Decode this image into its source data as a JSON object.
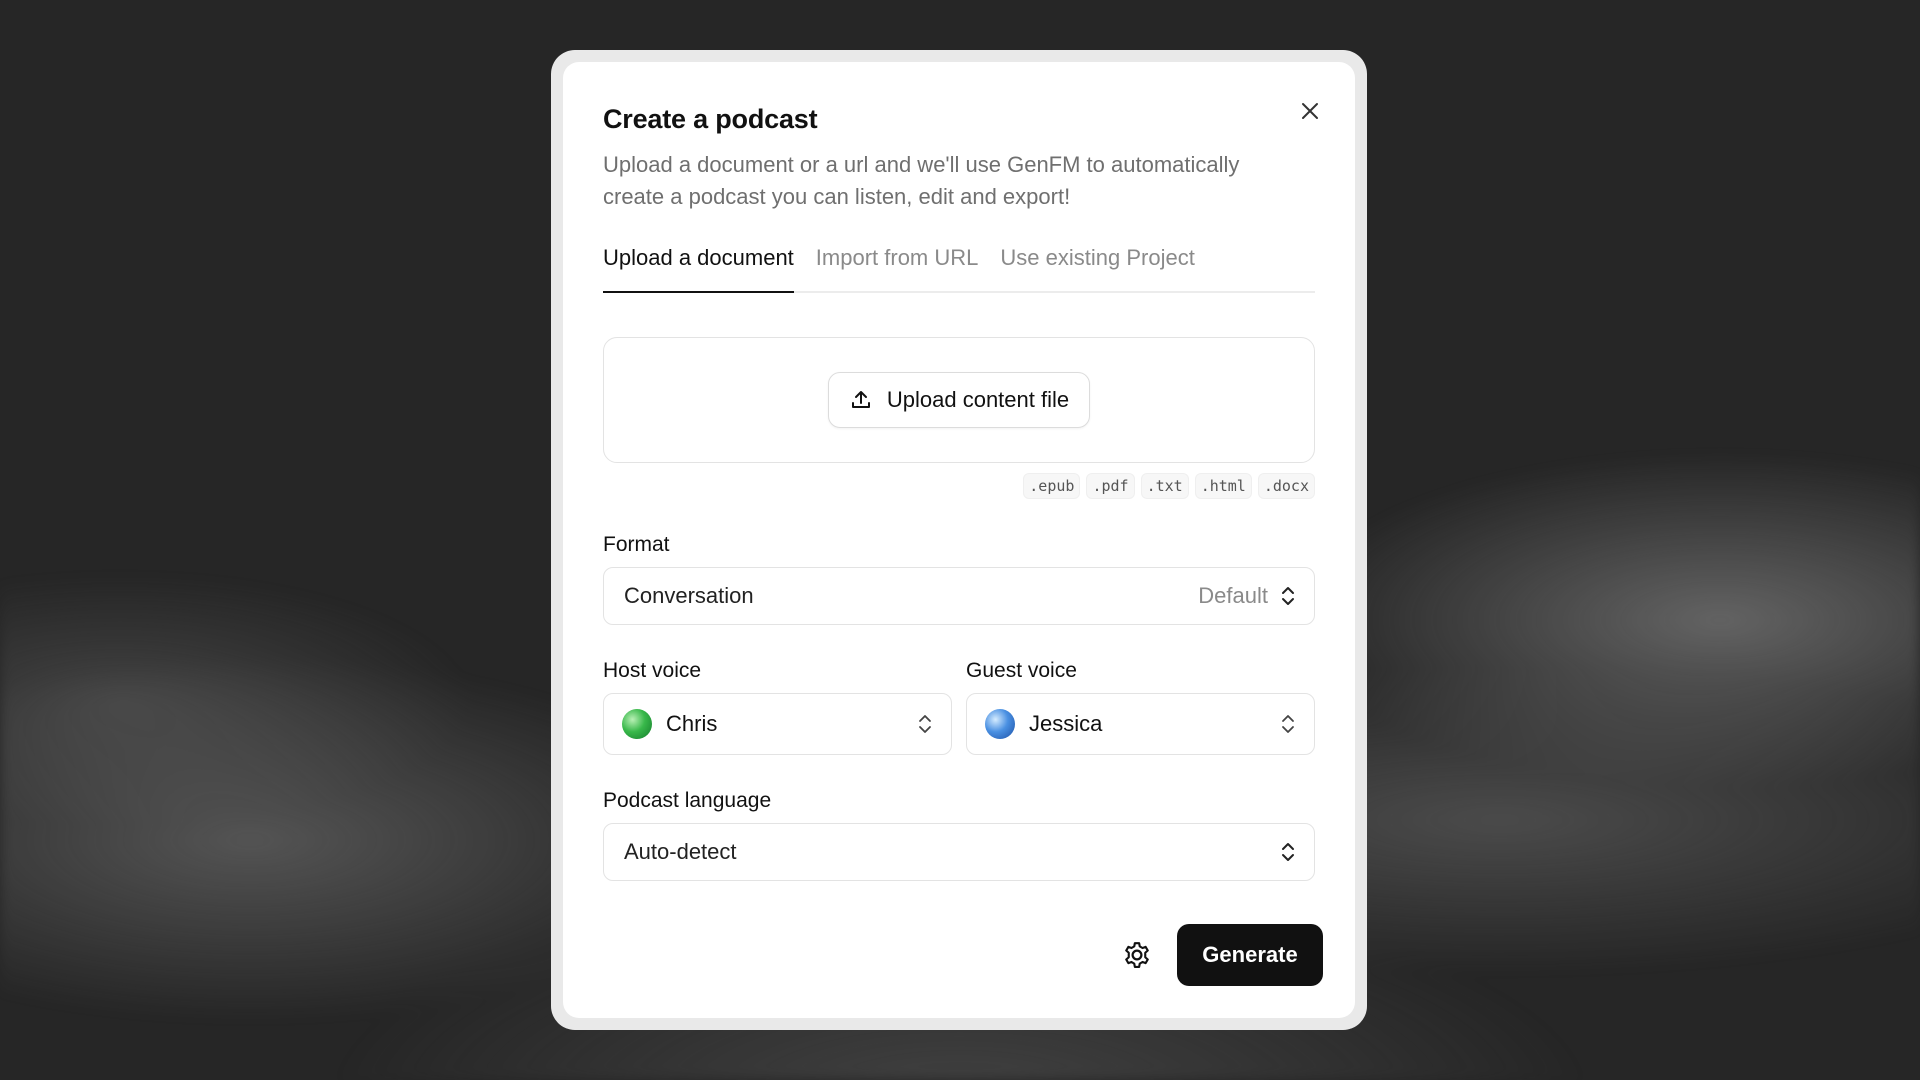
{
  "dialog": {
    "title": "Create a podcast",
    "subtitle": "Upload a document or a url and we'll use GenFM to automatically create a podcast you can listen, edit and export!",
    "close_icon": "close-icon"
  },
  "tabs": [
    {
      "label": "Upload a document",
      "active": true
    },
    {
      "label": "Import from URL",
      "active": false
    },
    {
      "label": "Use existing Project",
      "active": false
    }
  ],
  "upload": {
    "button_label": "Upload content file",
    "icon": "upload-icon",
    "extensions": [
      ".epub",
      ".pdf",
      ".txt",
      ".html",
      ".docx"
    ]
  },
  "format": {
    "label": "Format",
    "value": "Conversation",
    "hint": "Default"
  },
  "host_voice": {
    "label": "Host voice",
    "value": "Chris",
    "avatar_color": "#38b84a"
  },
  "guest_voice": {
    "label": "Guest voice",
    "value": "Jessica",
    "avatar_color": "#4a90e2"
  },
  "language": {
    "label": "Podcast language",
    "value": "Auto-detect"
  },
  "footer": {
    "settings_icon": "gear-icon",
    "generate_label": "Generate"
  },
  "colors": {
    "primary_button": "#111111",
    "backdrop": "#262626"
  }
}
